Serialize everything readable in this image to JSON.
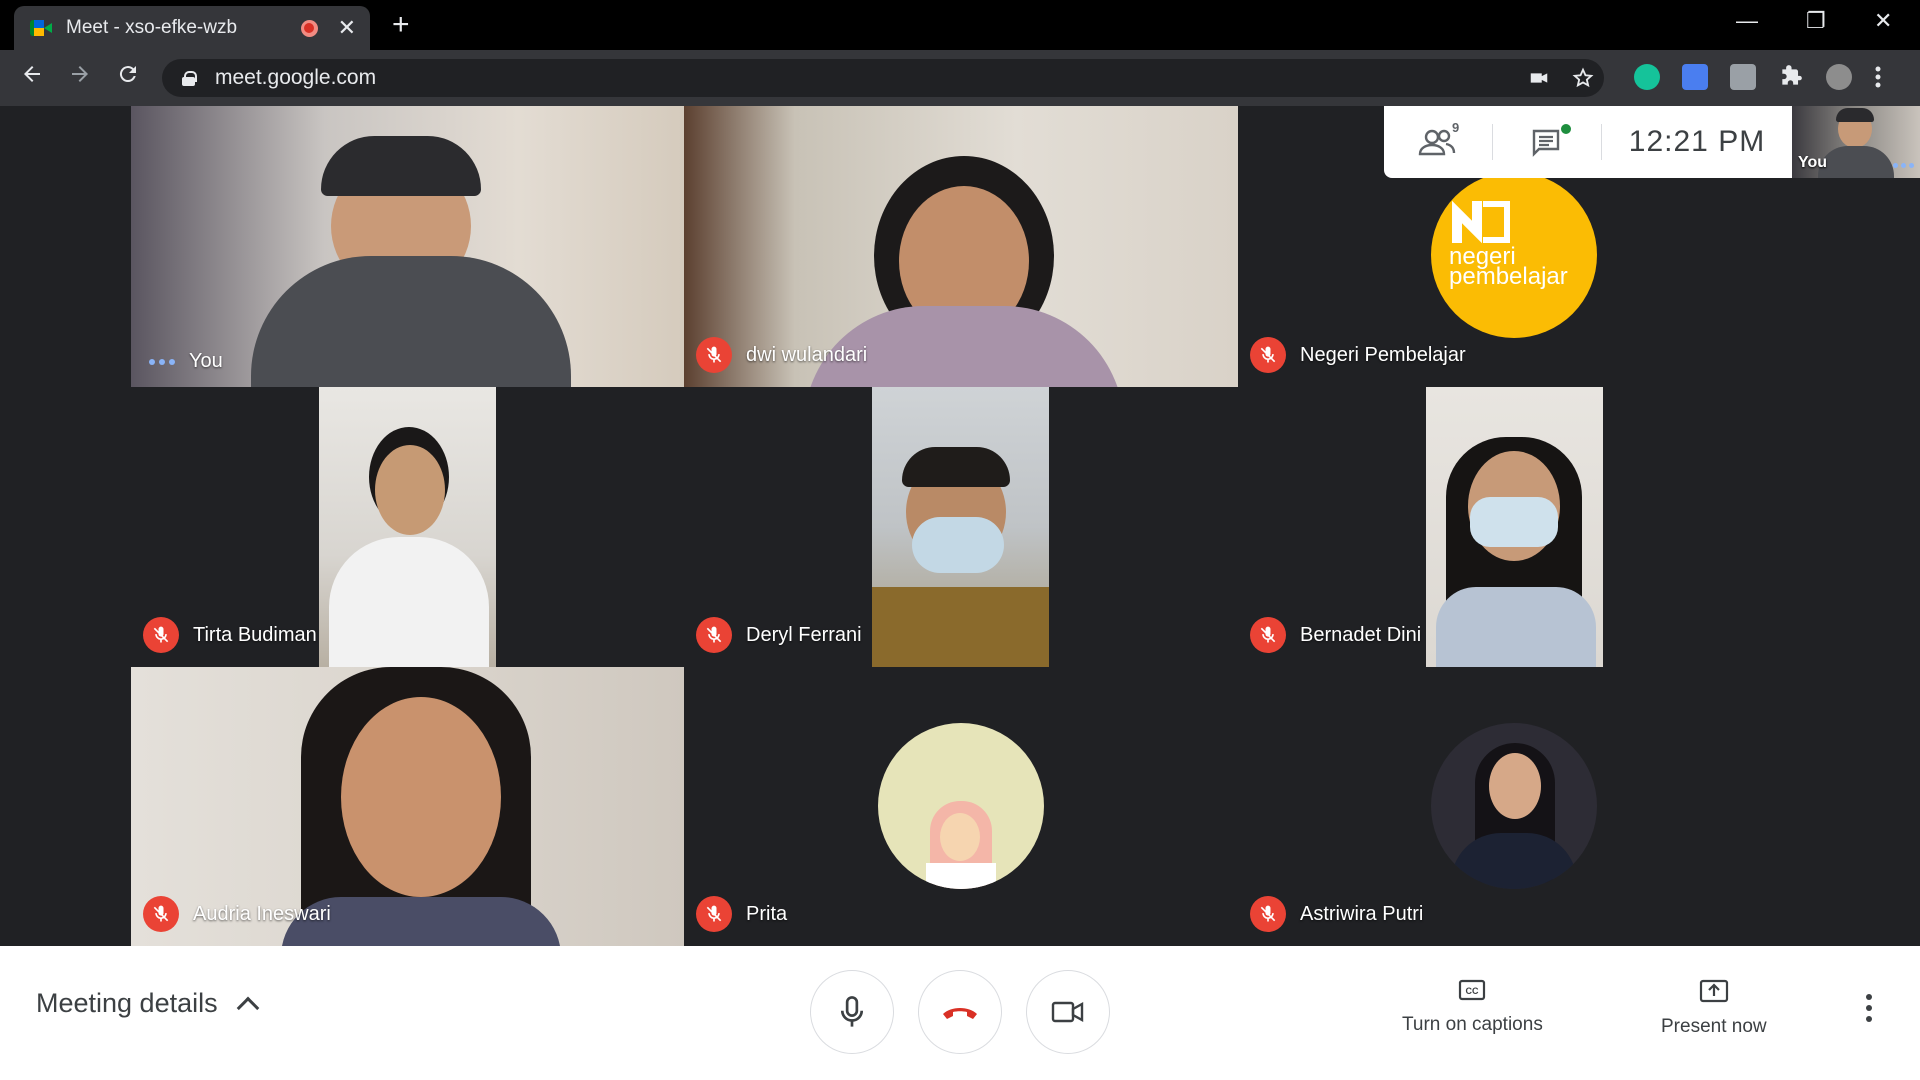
{
  "browser": {
    "tab_title": "Meet - xso-efke-wzb",
    "tab_close": "✕",
    "new_tab": "+",
    "url": "meet.google.com",
    "window_controls": [
      "—",
      "❐",
      "✕"
    ]
  },
  "participants": [
    {
      "name": "You",
      "muted": false,
      "speaking_indicator": true
    },
    {
      "name": "dwi wulandari",
      "muted": true
    },
    {
      "name": "Negeri Pembelajar",
      "muted": true
    },
    {
      "name": "Tirta Budiman",
      "muted": true
    },
    {
      "name": "Deryl Ferrani",
      "muted": true
    },
    {
      "name": "Bernadet Dini",
      "muted": true
    },
    {
      "name": "Audria Ineswari",
      "muted": true
    },
    {
      "name": "Prita",
      "muted": true
    },
    {
      "name": "Astriwira Putri",
      "muted": true
    }
  ],
  "logo": {
    "line1": "negeri",
    "line2": "pembelajar",
    "color": "#fbbc04"
  },
  "info_panel": {
    "people_badge": "9",
    "clock": "12:21 PM",
    "self_label": "You"
  },
  "bottom": {
    "meeting_details": "Meeting details",
    "captions_label": "Turn on captions",
    "present_label": "Present now"
  },
  "colors": {
    "mute_red": "#ea4335",
    "hangup_red": "#d93025",
    "stage_bg": "#202124"
  }
}
